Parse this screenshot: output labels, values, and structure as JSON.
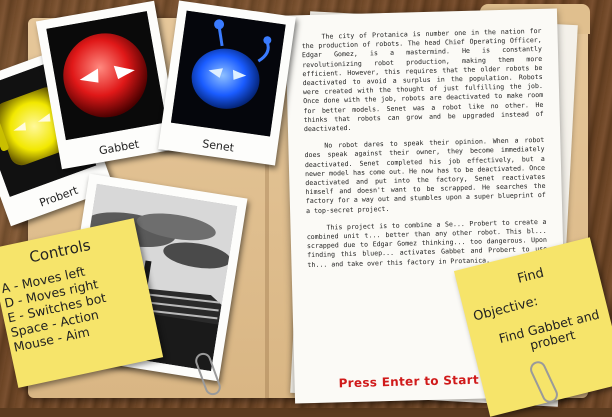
{
  "photos": [
    {
      "name": "Probert",
      "color": "#f2e800"
    },
    {
      "name": "Gabbet",
      "color": "#e01818"
    },
    {
      "name": "Senet",
      "color": "#1a5cff"
    }
  ],
  "document": {
    "paragraphs": [
      "The city of Protanica is number one in the nation for the production of robots. The head Chief Operating Officer, Edgar Gomez, is a mastermind. He is constantly revolutionizing robot production, making them more efficient. However, this requires that the older robots be deactivated to avoid a surplus in the population. Robots were created with the thought of just fulfilling the job. Once done with the job, robots are deactivated to make room for better models. Senet was a robot like no other. He thinks that robots can grow and be upgraded instead of deactivated.",
      "No robot dares to speak their opinion. When a robot does speak against their owner, they become immediately deactivated. Senet completed his job effectively, but a newer model has come out. He now has to be deactivated. Once deactivated and put into the factory, Senet reactivates himself and doesn't want to be scrapped. He searches the factory for a way out and stumbles upon a super blueprint of a top-secret project.",
      "This project is to combine a Se... Probert to create a combined unit t... better than any other robot. This bl... scrapped due to Edgar Gomez thinking... too dangerous. Upon finding this bluep... activates Gabbet and Probert to use th... and take over this factory in Protanica."
    ],
    "press_start": "Press Enter to Start"
  },
  "controls": {
    "title": "Controls",
    "items": [
      "A - Moves left",
      "D - Moves right",
      "E - Switches bot",
      "Space - Action",
      "Mouse - Aim"
    ]
  },
  "objective": {
    "label": "Objective:",
    "title": "Find",
    "text": "Find Gabbet and probert"
  }
}
